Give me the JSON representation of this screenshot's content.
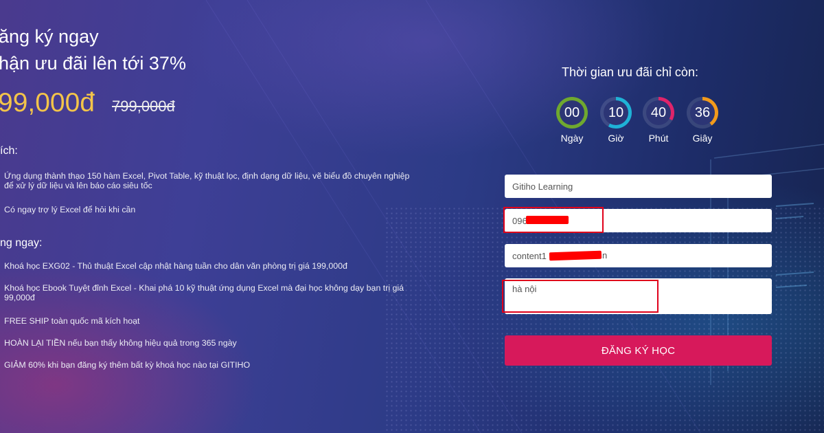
{
  "promo": {
    "title_line1": "ăng ký ngay",
    "title_line2": "hận ưu đãi lên tới 37%",
    "price": "99,000đ",
    "old_price": "799,000đ"
  },
  "benefits": {
    "title": "ích:",
    "items": [
      "Ứng dụng thành thạo 150 hàm Excel, Pivot Table, kỹ thuật lọc, định dạng dữ liệu, vẽ biểu đồ chuyên nghiệp để xử lý dữ liệu và lên báo cáo siêu tốc",
      "Có ngay trợ lý Excel để hỏi khi cần"
    ]
  },
  "bonuses": {
    "title": "ng ngay:",
    "items": [
      "Khoá học EXG02 - Thủ thuật Excel cập nhật hàng tuần cho dân văn phòng trị giá 199,000đ",
      "Khoá học Ebook Tuyệt đỉnh Excel - Khai phá 10 kỹ thuật ứng dụng Excel mà đại học không dạy bạn trị giá 99,000đ",
      "FREE SHIP toàn quốc mã kích hoạt",
      "HOÀN LẠI TIỀN nếu bạn thấy không hiệu quả trong 365 ngày",
      "GIẢM 60% khi bạn đăng ký thêm bất kỳ khoá học nào tại GITIHO"
    ]
  },
  "countdown": {
    "title": "Thời gian ưu đãi chỉ còn:",
    "timers": [
      {
        "value": "00",
        "label": "Ngày",
        "color": "#6fa82f",
        "fraction": 0.0
      },
      {
        "value": "10",
        "label": "Giờ",
        "color": "#1fb2d6",
        "fraction": 0.42
      },
      {
        "value": "40",
        "label": "Phút",
        "color": "#e0246a",
        "fraction": 0.67
      },
      {
        "value": "36",
        "label": "Giây",
        "color": "#f29a1b",
        "fraction": 0.6
      }
    ]
  },
  "form": {
    "name_value": "Gitiho Learning",
    "phone_value": "096",
    "email_value_prefix": "content1",
    "email_value_suffix": "n",
    "address_value": "hà nội",
    "submit_label": "ĐĂNG KÝ HỌC"
  },
  "colors": {
    "accent_price": "#f3c44a",
    "submit_button": "#d7195b",
    "highlight_box": "#e0001a"
  }
}
